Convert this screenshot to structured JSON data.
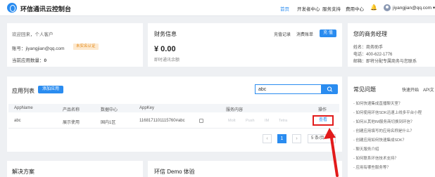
{
  "nav": {
    "brand": "环信通讯云控制台",
    "items": [
      "首页",
      "开发者中心",
      "服务支持",
      "费用中心"
    ],
    "active_index": 0,
    "user": "jiyangjian@qq.com"
  },
  "account": {
    "welcome": "欢迎回来，个人客户",
    "account_label": "账号：jiyangjian@qq.com",
    "cert_badge": "未实名认证",
    "app_count_label": "当前应用数量：",
    "app_count": "0"
  },
  "finance": {
    "title": "财务信息",
    "links": [
      "充值记录",
      "消费账单"
    ],
    "recharge_btn": "充 值",
    "balance": "¥ 0.00",
    "balance_caption": "即时通讯余额"
  },
  "manager": {
    "title": "您的商务经理",
    "name": "姓名：商务助手",
    "phone": "电话：400-622-1776",
    "email": "邮箱：即将分配专属商务与您联系"
  },
  "apps": {
    "title": "应用列表",
    "add_btn": "添加应用",
    "search_value": "abc",
    "columns": [
      "AppName",
      "产品名称",
      "数据中心",
      "AppKey",
      "服务内容",
      "操作"
    ],
    "rows": [
      {
        "app_name": "abc",
        "product": "展示使用",
        "datacenter": "国内1区",
        "appkey": "1168171101115760#abc",
        "services": [
          "MoIt",
          "Push",
          "IM",
          "Tetra"
        ],
        "action": "查看"
      }
    ],
    "pagination": {
      "prev": "‹",
      "current": "1",
      "next": "›",
      "page_size": "5 条/页"
    }
  },
  "faq": {
    "title": "常见问题",
    "links": [
      "快速开始",
      "API文"
    ],
    "items": [
      "- 如何快速集成直播聊天室？",
      "- 如何使用环信SDK迅速上线多平台小程",
      "- 如何从其他IM服务商切换到环信？",
      "- 创建应用填写的应用名称是什么？",
      "- 创建应用如何快速集成SDK？",
      "- 聊天服务介绍",
      "- 如何联系环信技术支持？",
      "- 应用有哪些服务等？"
    ]
  },
  "bottom": {
    "solutions_title": "解决方案",
    "demo_title": "环信 Demo 体验"
  },
  "colors": {
    "accent": "#2a8cf0",
    "highlight": "#e21b1b",
    "badge": "#e38a1a"
  }
}
